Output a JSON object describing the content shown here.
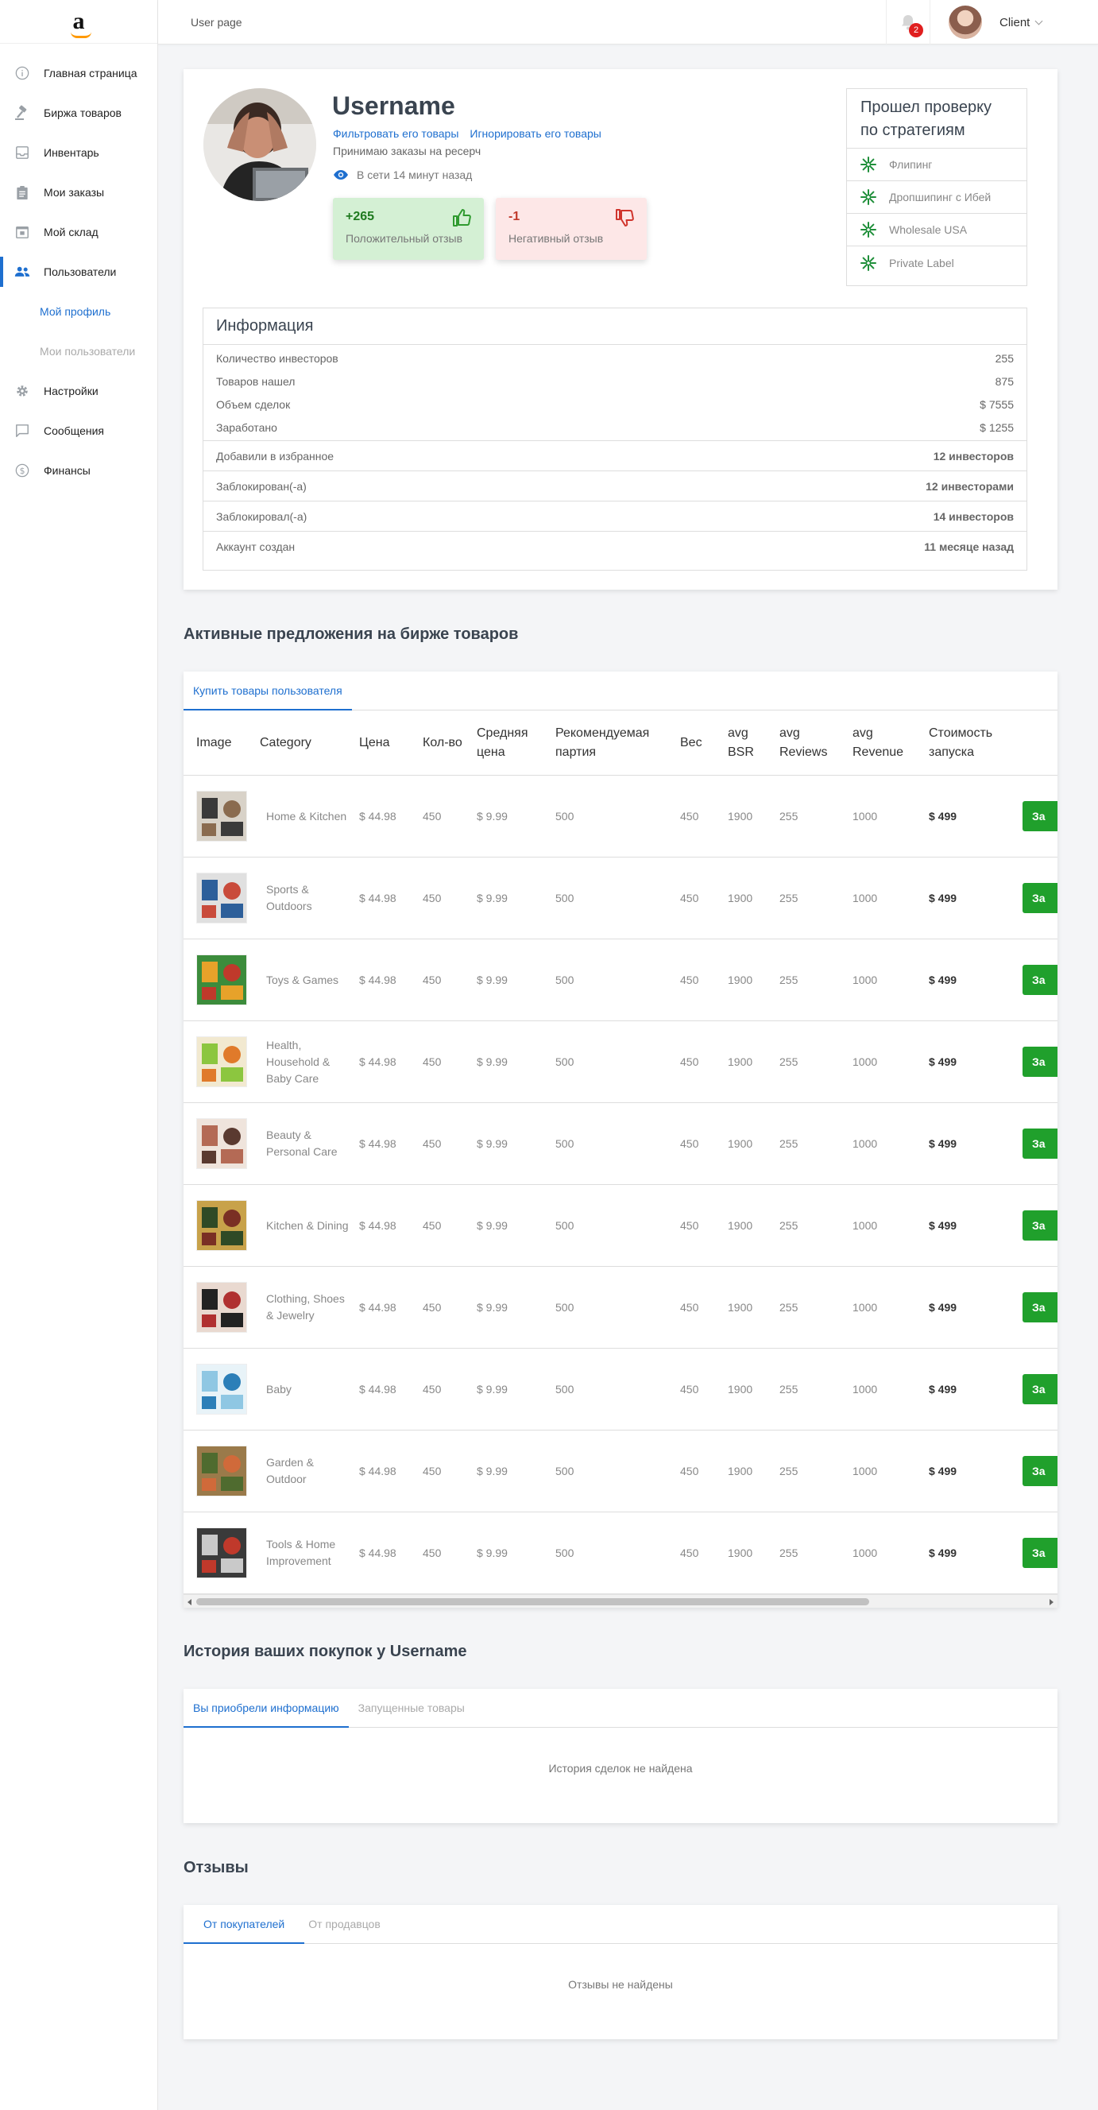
{
  "sidebar": {
    "logo_text": "a",
    "items": [
      {
        "label": "Главная страница",
        "icon": "info-icon"
      },
      {
        "label": "Биржа товаров",
        "icon": "gavel-icon"
      },
      {
        "label": "Инвентарь",
        "icon": "inbox-icon"
      },
      {
        "label": "Мои заказы",
        "icon": "clipboard-icon"
      },
      {
        "label": "Мой склад",
        "icon": "warehouse-icon"
      },
      {
        "label": "Пользователи",
        "icon": "users-icon"
      },
      {
        "label": "Настройки",
        "icon": "gear-icon"
      },
      {
        "label": "Сообщения",
        "icon": "chat-icon"
      },
      {
        "label": "Финансы",
        "icon": "dollar-icon"
      }
    ],
    "sub_items": [
      {
        "label": "Мой профиль"
      },
      {
        "label": "Мои пользователи"
      }
    ]
  },
  "topbar": {
    "breadcrumb": "User page",
    "notifications_count": "2",
    "client_name": "Client"
  },
  "profile": {
    "username": "Username",
    "filter_link": "Фильтровать его товары",
    "ignore_link": "Игнорировать его товары",
    "accepts": "Принимаю заказы на ресерч",
    "online": "В сети 14 минут назад",
    "positive": {
      "value": "+265",
      "label": "Положительный отзыв"
    },
    "negative": {
      "value": "-1",
      "label": "Негативный отзыв"
    },
    "colors": {
      "accent": "#1e6fcf",
      "positive_bg": "#d4f0d4",
      "negative_bg": "#fde7e7"
    }
  },
  "strategies": {
    "title": "Прошел проверку по стратегиям",
    "items": [
      "Флипинг",
      "Дропшипинг с Ибей",
      "Wholesale USA",
      "Private Label"
    ]
  },
  "info": {
    "title": "Информация",
    "rows_small": [
      {
        "label": "Количество инвесторов",
        "value": "255"
      },
      {
        "label": "Товаров нашел",
        "value": "875"
      },
      {
        "label": "Объем сделок",
        "value": "$ 7555"
      },
      {
        "label": "Заработано",
        "value": "$ 1255"
      }
    ],
    "rows_large": [
      {
        "label": "Добавили в избранное",
        "value": "12 инвесторов"
      },
      {
        "label": "Заблокирован(-а)",
        "value": "12 инвесторами"
      },
      {
        "label": "Заблокировал(-а)",
        "value": "14 инвесторов"
      },
      {
        "label": "Аккаунт создан",
        "value": "11 месяце назад"
      }
    ]
  },
  "offers": {
    "title": "Активные предложения на бирже товаров",
    "tab": "Купить товары пользователя",
    "columns": [
      "Image",
      "Category",
      "Цена",
      "Кол-во",
      "Средняя цена",
      "Рекомендуемая партия",
      "Вес",
      "avg BSR",
      "avg Reviews",
      "avg Revenue",
      "Стоимость запуска"
    ],
    "button_label": "За",
    "rows": [
      {
        "category": "Home & Kitchen",
        "price": "$ 44.98",
        "qty": "450",
        "avg_price": "$ 9.99",
        "rec": "500",
        "weight": "450",
        "bsr": "1900",
        "reviews": "255",
        "revenue": "1000",
        "cost": "$ 499"
      },
      {
        "category": "Sports & Outdoors",
        "price": "$ 44.98",
        "qty": "450",
        "avg_price": "$ 9.99",
        "rec": "500",
        "weight": "450",
        "bsr": "1900",
        "reviews": "255",
        "revenue": "1000",
        "cost": "$ 499"
      },
      {
        "category": "Toys & Games",
        "price": "$ 44.98",
        "qty": "450",
        "avg_price": "$ 9.99",
        "rec": "500",
        "weight": "450",
        "bsr": "1900",
        "reviews": "255",
        "revenue": "1000",
        "cost": "$ 499"
      },
      {
        "category": "Health, Household & Baby Care",
        "price": "$ 44.98",
        "qty": "450",
        "avg_price": "$ 9.99",
        "rec": "500",
        "weight": "450",
        "bsr": "1900",
        "reviews": "255",
        "revenue": "1000",
        "cost": "$ 499"
      },
      {
        "category": "Beauty & Personal Care",
        "price": "$ 44.98",
        "qty": "450",
        "avg_price": "$ 9.99",
        "rec": "500",
        "weight": "450",
        "bsr": "1900",
        "reviews": "255",
        "revenue": "1000",
        "cost": "$ 499"
      },
      {
        "category": "Kitchen & Dining",
        "price": "$ 44.98",
        "qty": "450",
        "avg_price": "$ 9.99",
        "rec": "500",
        "weight": "450",
        "bsr": "1900",
        "reviews": "255",
        "revenue": "1000",
        "cost": "$ 499"
      },
      {
        "category": "Clothing, Shoes & Jewelry",
        "price": "$ 44.98",
        "qty": "450",
        "avg_price": "$ 9.99",
        "rec": "500",
        "weight": "450",
        "bsr": "1900",
        "reviews": "255",
        "revenue": "1000",
        "cost": "$ 499"
      },
      {
        "category": "Baby",
        "price": "$ 44.98",
        "qty": "450",
        "avg_price": "$ 9.99",
        "rec": "500",
        "weight": "450",
        "bsr": "1900",
        "reviews": "255",
        "revenue": "1000",
        "cost": "$ 499"
      },
      {
        "category": "Garden & Outdoor",
        "price": "$ 44.98",
        "qty": "450",
        "avg_price": "$ 9.99",
        "rec": "500",
        "weight": "450",
        "bsr": "1900",
        "reviews": "255",
        "revenue": "1000",
        "cost": "$ 499"
      },
      {
        "category": "Tools & Home Improvement",
        "price": "$ 44.98",
        "qty": "450",
        "avg_price": "$ 9.99",
        "rec": "500",
        "weight": "450",
        "bsr": "1900",
        "reviews": "255",
        "revenue": "1000",
        "cost": "$ 499"
      }
    ]
  },
  "history": {
    "title": "История ваших покупок у Username",
    "tabs": [
      "Вы приобрели информацию",
      "Запущенные товары"
    ],
    "empty": "История сделок не найдена"
  },
  "reviews": {
    "title": "Отзывы",
    "tabs": [
      "От покупателей",
      "От продавцов"
    ],
    "empty": "Отзывы не найдены"
  }
}
